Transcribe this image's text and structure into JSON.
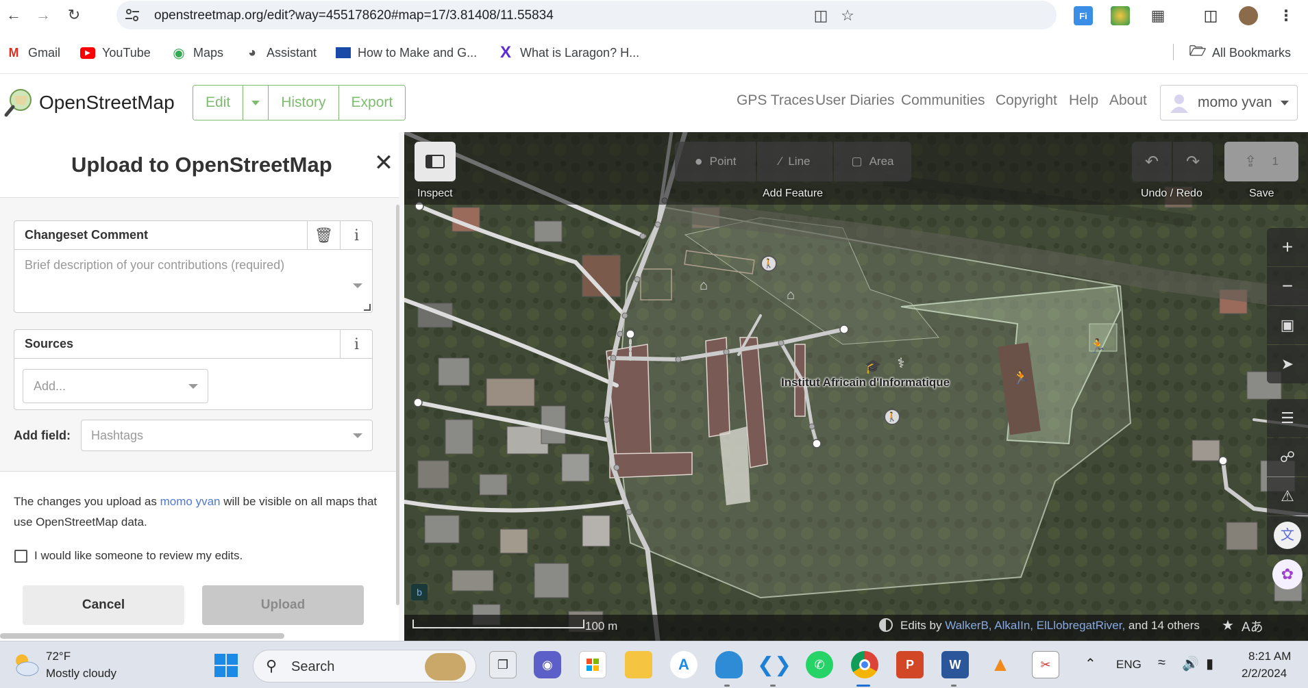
{
  "browser": {
    "url": "openstreetmap.org/edit?way=455178620#map=17/3.81408/11.55834",
    "bookmarks": [
      {
        "label": "Gmail",
        "icon": "gmail-icon"
      },
      {
        "label": "YouTube",
        "icon": "youtube-icon"
      },
      {
        "label": "Maps",
        "icon": "maps-icon"
      },
      {
        "label": "Assistant",
        "icon": "assistant-icon"
      },
      {
        "label": "How to Make and G...",
        "icon": "site-icon"
      },
      {
        "label": "What is Laragon? H...",
        "icon": "x-icon"
      }
    ],
    "all_bookmarks": "All Bookmarks"
  },
  "osm": {
    "brand": "OpenStreetMap",
    "edit": "Edit",
    "history": "History",
    "export": "Export",
    "nav": [
      "GPS Traces",
      "User Diaries",
      "Communities",
      "Copyright",
      "Help",
      "About"
    ],
    "user": "momo yvan"
  },
  "upload": {
    "title": "Upload to OpenStreetMap",
    "changeset_label": "Changeset Comment",
    "changeset_placeholder": "Brief description of your contributions (required)",
    "sources_label": "Sources",
    "sources_placeholder": "Add...",
    "add_field_label": "Add field:",
    "add_field_placeholder": "Hashtags",
    "info_prefix": "The changes you upload as ",
    "info_user": "momo yvan",
    "info_suffix": " will be visible on all maps that use OpenStreetMap data.",
    "review_label": "I would like someone to review my edits.",
    "cancel": "Cancel",
    "upload": "Upload"
  },
  "map": {
    "inspect": "Inspect",
    "point": "Point",
    "line": "Line",
    "area": "Area",
    "add_feature": "Add Feature",
    "undo_redo": "Undo / Redo",
    "save": "Save",
    "save_count": "1",
    "place_label": "Institut Africain d'Informatique",
    "scale": "100 m",
    "edits_by": "Edits by ",
    "edit_users": "WalkerB, AlkaIIn, ElLlobregatRiver,",
    "edits_and": " and ",
    "edits_count": "14",
    "edits_others": " others"
  },
  "taskbar": {
    "temp": "72°F",
    "weather": "Mostly cloudy",
    "search": "Search",
    "lang": "ENG",
    "time": "8:21 AM",
    "date": "2/2/2024"
  }
}
